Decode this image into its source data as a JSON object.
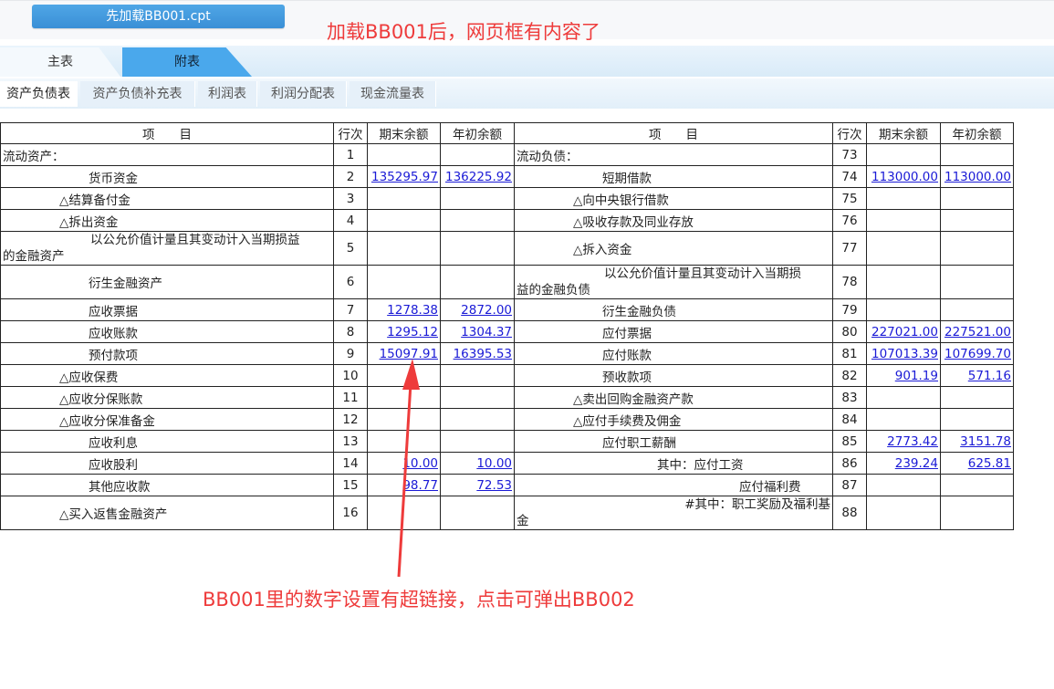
{
  "toolbar": {
    "load_button": "先加载BB001.cpt"
  },
  "annotations": {
    "top": "加载BB001后，网页框有内容了",
    "bottom": "BB001里的数字设置有超链接，点击可弹出BB002"
  },
  "main_tabs": [
    "主表",
    "附表"
  ],
  "sub_tabs": [
    "资产负债表",
    "资产负债补充表",
    "利润表",
    "利润分配表",
    "现金流量表"
  ],
  "table": {
    "headers": [
      "项　　目",
      "行次",
      "期末余额",
      "年初余额",
      "项　　目",
      "行次",
      "期末余额",
      "年初余额"
    ],
    "rows": [
      {
        "l_item": "流动资产：",
        "l_no": "1",
        "l_end": "",
        "l_begin": "",
        "r_item": "流动负债：",
        "r_no": "73",
        "r_end": "",
        "r_begin": ""
      },
      {
        "l_item": "货币资金",
        "l_no": "2",
        "l_end": "135295.97",
        "l_begin": "136225.92",
        "r_item": "短期借款",
        "r_no": "74",
        "r_end": "113000.00",
        "r_begin": "113000.00"
      },
      {
        "l_item": "△结算备付金",
        "l_no": "3",
        "l_end": "",
        "l_begin": "",
        "r_item": "△向中央银行借款",
        "r_no": "75",
        "r_end": "",
        "r_begin": ""
      },
      {
        "l_item": "△拆出资金",
        "l_no": "4",
        "l_end": "",
        "l_begin": "",
        "r_item": "△吸收存款及同业存放",
        "r_no": "76",
        "r_end": "",
        "r_begin": ""
      },
      {
        "l_item_a": "以公允价值计量且其变动计入当期损益",
        "l_item_b": "的金融资产",
        "l_no": "5",
        "l_end": "",
        "l_begin": "",
        "r_item": "△拆入资金",
        "r_no": "77",
        "r_end": "",
        "r_begin": ""
      },
      {
        "l_item": "衍生金融资产",
        "l_no": "6",
        "l_end": "",
        "l_begin": "",
        "r_item_a": "以公允价值计量且其变动计入当期损",
        "r_item_b": "益的金融负债",
        "r_no": "78",
        "r_end": "",
        "r_begin": ""
      },
      {
        "l_item": "应收票据",
        "l_no": "7",
        "l_end": "1278.38",
        "l_begin": "2872.00",
        "r_item": "衍生金融负债",
        "r_no": "79",
        "r_end": "",
        "r_begin": ""
      },
      {
        "l_item": "应收账款",
        "l_no": "8",
        "l_end": "1295.12",
        "l_begin": "1304.37",
        "r_item": "应付票据",
        "r_no": "80",
        "r_end": "227021.00",
        "r_begin": "227521.00"
      },
      {
        "l_item": "预付款项",
        "l_no": "9",
        "l_end": "15097.91",
        "l_begin": "16395.53",
        "r_item": "应付账款",
        "r_no": "81",
        "r_end": "107013.39",
        "r_begin": "107699.70"
      },
      {
        "l_item": "△应收保费",
        "l_no": "10",
        "l_end": "",
        "l_begin": "",
        "r_item": "预收款项",
        "r_no": "82",
        "r_end": "901.19",
        "r_begin": "571.16"
      },
      {
        "l_item": "△应收分保账款",
        "l_no": "11",
        "l_end": "",
        "l_begin": "",
        "r_item": "△卖出回购金融资产款",
        "r_no": "83",
        "r_end": "",
        "r_begin": ""
      },
      {
        "l_item": "△应收分保准备金",
        "l_no": "12",
        "l_end": "",
        "l_begin": "",
        "r_item": "△应付手续费及佣金",
        "r_no": "84",
        "r_end": "",
        "r_begin": ""
      },
      {
        "l_item": "应收利息",
        "l_no": "13",
        "l_end": "",
        "l_begin": "",
        "r_item": "应付职工薪酬",
        "r_no": "85",
        "r_end": "2773.42",
        "r_begin": "3151.78"
      },
      {
        "l_item": "应收股利",
        "l_no": "14",
        "l_end": "10.00",
        "l_begin": "10.00",
        "r_item": "其中：应付工资",
        "r_no": "86",
        "r_end": "239.24",
        "r_begin": "625.81"
      },
      {
        "l_item": "其他应收款",
        "l_no": "15",
        "l_end": "98.77",
        "l_begin": "72.53",
        "r_item": "应付福利费",
        "r_no": "87",
        "r_end": "",
        "r_begin": ""
      },
      {
        "l_item": "△买入返售金融资产",
        "l_no": "16",
        "l_end": "",
        "l_begin": "",
        "r_item_a": "#其中：职工奖励及福利基",
        "r_item_b": "金",
        "r_no": "88",
        "r_end": "",
        "r_begin": ""
      }
    ]
  },
  "colors": {
    "accent": "#4aa8ec",
    "link": "#1a1ad6",
    "annotation": "#ee3b3b"
  }
}
